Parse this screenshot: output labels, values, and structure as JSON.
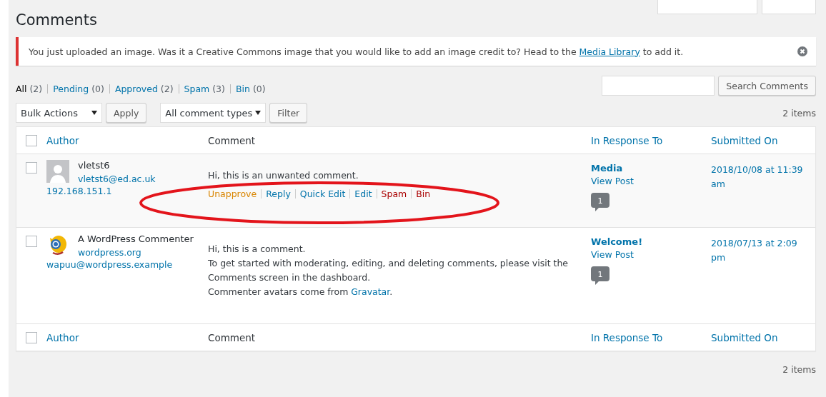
{
  "page_title": "Comments",
  "notice": {
    "text": "You just uploaded an image. Was it a Creative Commons image that you would like to add an image credit to? Head to the",
    "link": "Media Library",
    "after": "to add it."
  },
  "status_links": [
    {
      "label": "All",
      "count": "(2)",
      "selected": true
    },
    {
      "label": "Pending",
      "count": "(0)",
      "selected": false
    },
    {
      "label": "Approved",
      "count": "(2)",
      "selected": false
    },
    {
      "label": "Spam",
      "count": "(3)",
      "selected": false
    },
    {
      "label": "Bin",
      "count": "(0)",
      "selected": false
    }
  ],
  "search_button": "Search Comments",
  "bulk_actions": "Bulk Actions",
  "apply_button": "Apply",
  "type_filter": "All comment types",
  "filter_button": "Filter",
  "items_count_top": "2 items",
  "columns": [
    "Author",
    "Comment",
    "In Response To",
    "Submitted On"
  ],
  "select_all_checked": false,
  "rows": [
    {
      "avatar": {
        "kind": "silhouette"
      },
      "name": "vletst6",
      "site": "vletst6@ed.ac.uk",
      "email": "192.168.151.1",
      "checked": false,
      "highlighted": true,
      "comment": [
        {
          "text": "Hi, this is an unwanted comment."
        }
      ],
      "actions": [
        {
          "label": "Unapprove",
          "kind": "warn"
        },
        {
          "label": "Reply",
          "kind": "normal"
        },
        {
          "label": "Quick Edit",
          "kind": "normal"
        },
        {
          "label": "Edit",
          "kind": "normal"
        },
        {
          "label": "Spam",
          "kind": "danger"
        },
        {
          "label": "Bin",
          "kind": "danger"
        }
      ],
      "circled": true,
      "post": "Media",
      "view_post": "View Post",
      "comment_count": "1",
      "date": "2018/10/08 at 11:39 am"
    },
    {
      "avatar": {
        "kind": "mascot"
      },
      "name": "A WordPress Commenter",
      "site": "wordpress.org",
      "email": "wapuu@wordpress.example",
      "checked": false,
      "highlighted": false,
      "comment": [
        {
          "text": "Hi, this is a comment."
        },
        {
          "text": "To get started with moderating, editing, and deleting comments, please visit the Comments screen in the dashboard."
        },
        {
          "text": "Commenter avatars come from",
          "link": "Gravatar",
          "after": "."
        }
      ],
      "actions": [],
      "circled": false,
      "post": "Welcome!",
      "view_post": "View Post",
      "comment_count": "1",
      "date": "2018/07/13 at 2:09 pm"
    }
  ],
  "footer_columns": [
    "Author",
    "Comment",
    "In Response To",
    "Submitted On"
  ],
  "footer_select_all_checked": false,
  "items_count_bottom": "2 items"
}
